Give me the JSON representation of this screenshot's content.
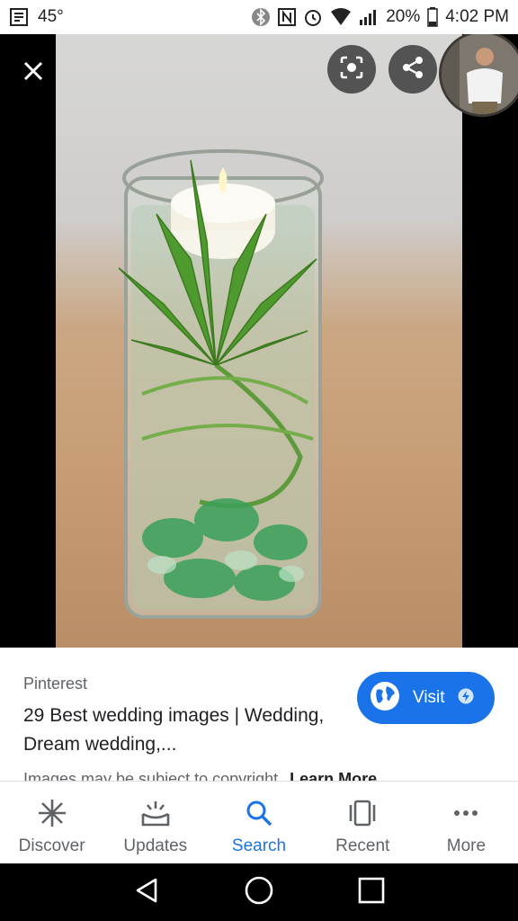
{
  "status_bar": {
    "temperature": "45°",
    "battery": "20%",
    "time": "4:02 PM"
  },
  "viewer": {
    "close_icon": "close-icon",
    "lens_icon": "lens-icon",
    "share_icon": "share-icon"
  },
  "result": {
    "source": "Pinterest",
    "title": "29 Best wedding images | Wedding, Dream wedding,...",
    "visit_label": "Visit",
    "copyright_text": "Images may be subject to copyright.",
    "learn_more": "Learn More"
  },
  "bottom_nav": {
    "items": [
      {
        "label": "Discover",
        "icon": "asterisk-icon"
      },
      {
        "label": "Updates",
        "icon": "updates-icon"
      },
      {
        "label": "Search",
        "icon": "search-icon"
      },
      {
        "label": "Recent",
        "icon": "recent-icon"
      },
      {
        "label": "More",
        "icon": "more-icon"
      }
    ],
    "active": "Search"
  },
  "colors": {
    "accent": "#1a73e8",
    "text": "#202124",
    "secondary": "#5f6368"
  }
}
